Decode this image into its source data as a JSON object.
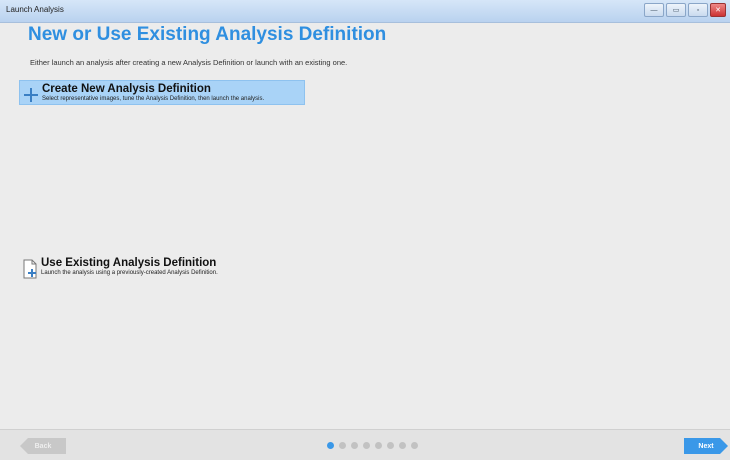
{
  "window": {
    "title": "Launch Analysis",
    "buttons": [
      "—",
      "▭",
      "▫",
      "✕"
    ]
  },
  "header": {
    "title": "New or Use Existing Analysis Definition",
    "subtitle": "Either launch an analysis after creating a new Analysis Definition or launch with an existing one."
  },
  "options": [
    {
      "title": "Create New Analysis Definition",
      "description": "Select representative images, tune the Analysis Definition, then launch the analysis.",
      "icon": "plus-icon",
      "selected": true
    },
    {
      "title": "Use Existing Analysis Definition",
      "description": "Launch the analysis using a previously-created Analysis Definition.",
      "icon": "document-add-icon",
      "selected": false
    }
  ],
  "footer": {
    "back_label": "Back",
    "next_label": "Next",
    "steps_total": 8,
    "current_step": 1
  },
  "colors": {
    "accent": "#2f8fe0",
    "selected_bg": "#a9d3f7",
    "next_bg": "#3a98e8"
  }
}
